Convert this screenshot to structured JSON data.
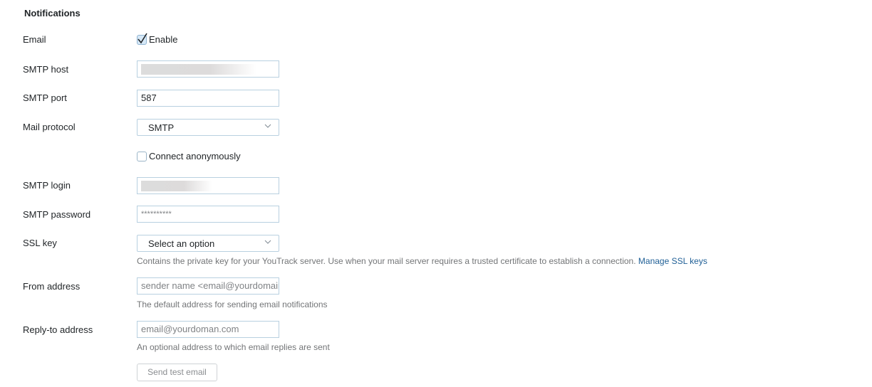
{
  "section_title": "Notifications",
  "fields": {
    "email": {
      "label": "Email",
      "checkbox_label": "Enable",
      "checked": true
    },
    "smtp_host": {
      "label": "SMTP host",
      "value": ""
    },
    "smtp_port": {
      "label": "SMTP port",
      "value": "587"
    },
    "mail_protocol": {
      "label": "Mail protocol",
      "selected": "SMTP"
    },
    "connect_anonymously": {
      "checkbox_label": "Connect anonymously",
      "checked": false
    },
    "smtp_login": {
      "label": "SMTP login",
      "value": ""
    },
    "smtp_password": {
      "label": "SMTP password",
      "value": "**********"
    },
    "ssl_key": {
      "label": "SSL key",
      "selected": "Select an option",
      "hint": "Contains the private key for your YouTrack server. Use when your mail server requires a trusted certificate to establish a connection. ",
      "link": "Manage SSL keys"
    },
    "from_address": {
      "label": "From address",
      "placeholder": "sender name <email@yourdomain.com>",
      "hint": "The default address for sending email notifications"
    },
    "reply_to_address": {
      "label": "Reply-to address",
      "placeholder": "email@yourdoman.com",
      "hint": "An optional address to which email replies are sent"
    }
  },
  "buttons": {
    "send_test_email": "Send test email"
  }
}
